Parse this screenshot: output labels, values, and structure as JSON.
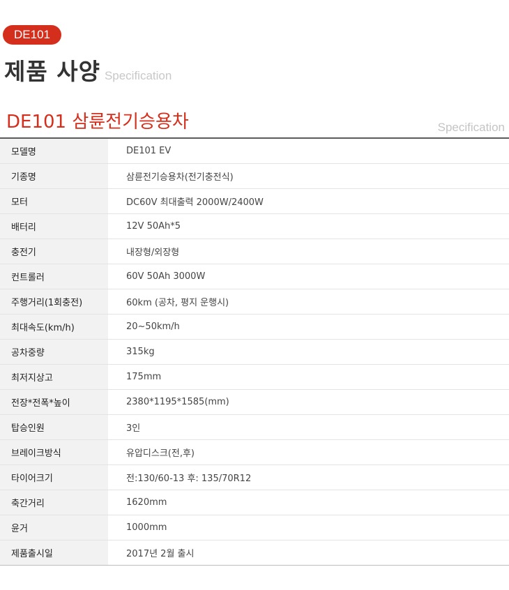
{
  "header": {
    "badge": "DE101",
    "title": "제품 사양",
    "title_en": "Specification"
  },
  "product": {
    "name": "DE101 삼륜전기승용차",
    "spec_label": "Specification"
  },
  "specs": [
    {
      "label": "모델명",
      "value": "DE101 EV"
    },
    {
      "label": "기종명",
      "value": "삼륜전기승용차(전기충전식)"
    },
    {
      "label": "모터",
      "value": "DC60V 최대출력 2000W/2400W"
    },
    {
      "label": "배터리",
      "value": "12V 50Ah*5"
    },
    {
      "label": "충전기",
      "value": "내장형/외장형"
    },
    {
      "label": "컨트롤러",
      "value": "60V 50Ah 3000W"
    },
    {
      "label": "주행거리(1회충전)",
      "value": "60km (공차, 평지 운행시)"
    },
    {
      "label": "최대속도(km/h)",
      "value": "20~50km/h"
    },
    {
      "label": "공차중량",
      "value": "315kg"
    },
    {
      "label": "최저지상고",
      "value": "175mm"
    },
    {
      "label": "전장*전폭*높이",
      "value": "2380*1195*1585(mm)"
    },
    {
      "label": "탑승인원",
      "value": "3인"
    },
    {
      "label": "브레이크방식",
      "value": "유압디스크(전,후)"
    },
    {
      "label": "타이어크기",
      "value": "전:130/60-13 후: 135/70R12"
    },
    {
      "label": "축간거리",
      "value": "1620mm"
    },
    {
      "label": "윤거",
      "value": "1000mm"
    },
    {
      "label": "제품출시일",
      "value": "2017년 2월 출시"
    }
  ]
}
